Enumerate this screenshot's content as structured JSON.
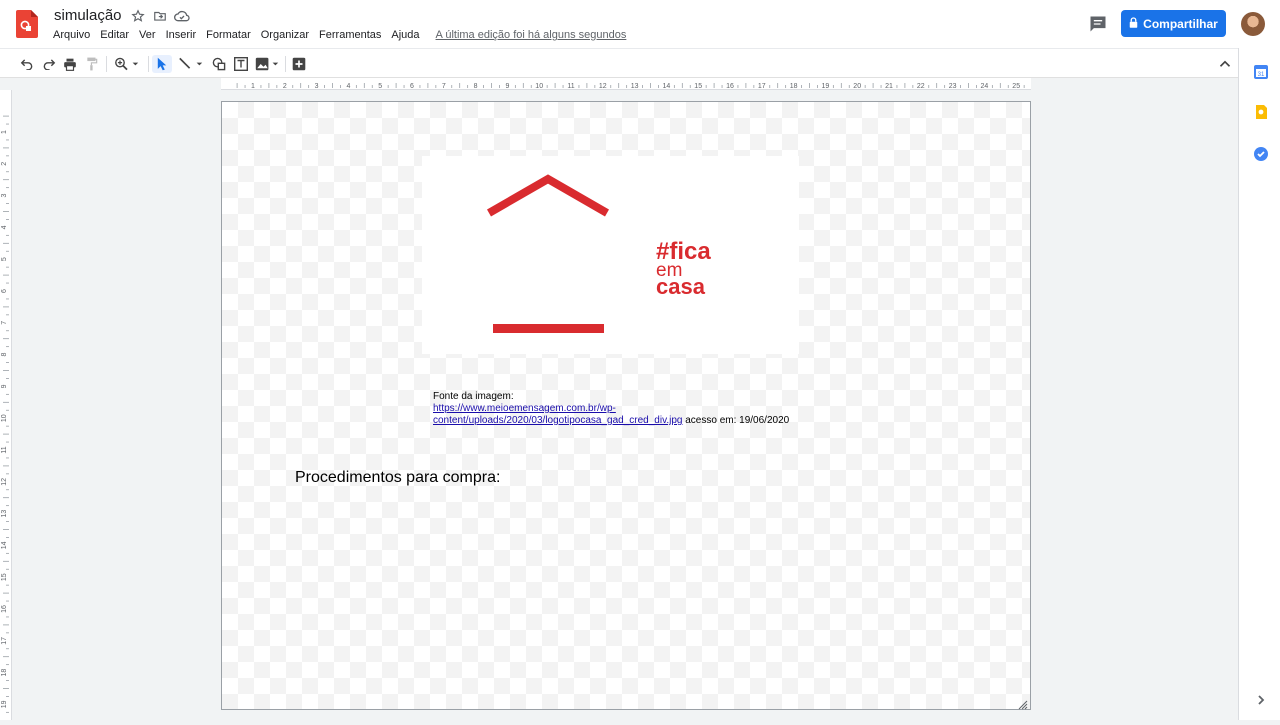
{
  "header": {
    "title": "simulação",
    "menu": [
      "Arquivo",
      "Editar",
      "Ver",
      "Inserir",
      "Formatar",
      "Organizar",
      "Ferramentas",
      "Ajuda"
    ],
    "last_edit": "A última edição foi há alguns segundos",
    "share_label": "Compartilhar",
    "icons": [
      "drawings-logo-icon",
      "star-icon",
      "move-folder-icon",
      "cloud-status-icon",
      "comments-icon",
      "lock-icon",
      "avatar"
    ]
  },
  "toolbar": {
    "icons": [
      "undo-icon",
      "redo-icon",
      "print-icon",
      "paint-format-icon",
      "zoom-icon",
      "select-icon",
      "line-icon",
      "shape-icon",
      "text-box-icon",
      "image-icon",
      "add-icon",
      "collapse-icon"
    ]
  },
  "ruler": {
    "h_labels": [
      "1",
      "2",
      "3",
      "4",
      "5",
      "6",
      "7",
      "8",
      "9",
      "10",
      "11",
      "12",
      "13",
      "14",
      "15",
      "16",
      "17",
      "18",
      "19",
      "20",
      "21",
      "22",
      "23",
      "24",
      "25"
    ],
    "v_labels": [
      "1",
      "2",
      "3",
      "4",
      "5",
      "6",
      "7",
      "8",
      "9",
      "10",
      "11",
      "12",
      "13",
      "14",
      "15",
      "16",
      "17",
      "18",
      "19"
    ]
  },
  "canvas": {
    "logo": {
      "hashtag_line": "#fica",
      "line2": "em",
      "line3": "casa",
      "brand_color": "#d92b2f"
    },
    "source_label": "Fonte da imagem:",
    "source_url": "https://www.meioemensagem.com.br/wp-content/uploads/2020/03/logotipocasa_gad_cred_div.jpg",
    "access_text": " acesso em: 19/06/2020",
    "heading": "Procedimentos para compra:"
  },
  "sidepanel": {
    "icons": [
      "calendar-icon",
      "keep-icon",
      "tasks-icon",
      "expand-panel-icon"
    ]
  },
  "colors": {
    "accent": "#1a73e8",
    "app_red": "#ea4335",
    "logo_red": "#d92b2f"
  }
}
